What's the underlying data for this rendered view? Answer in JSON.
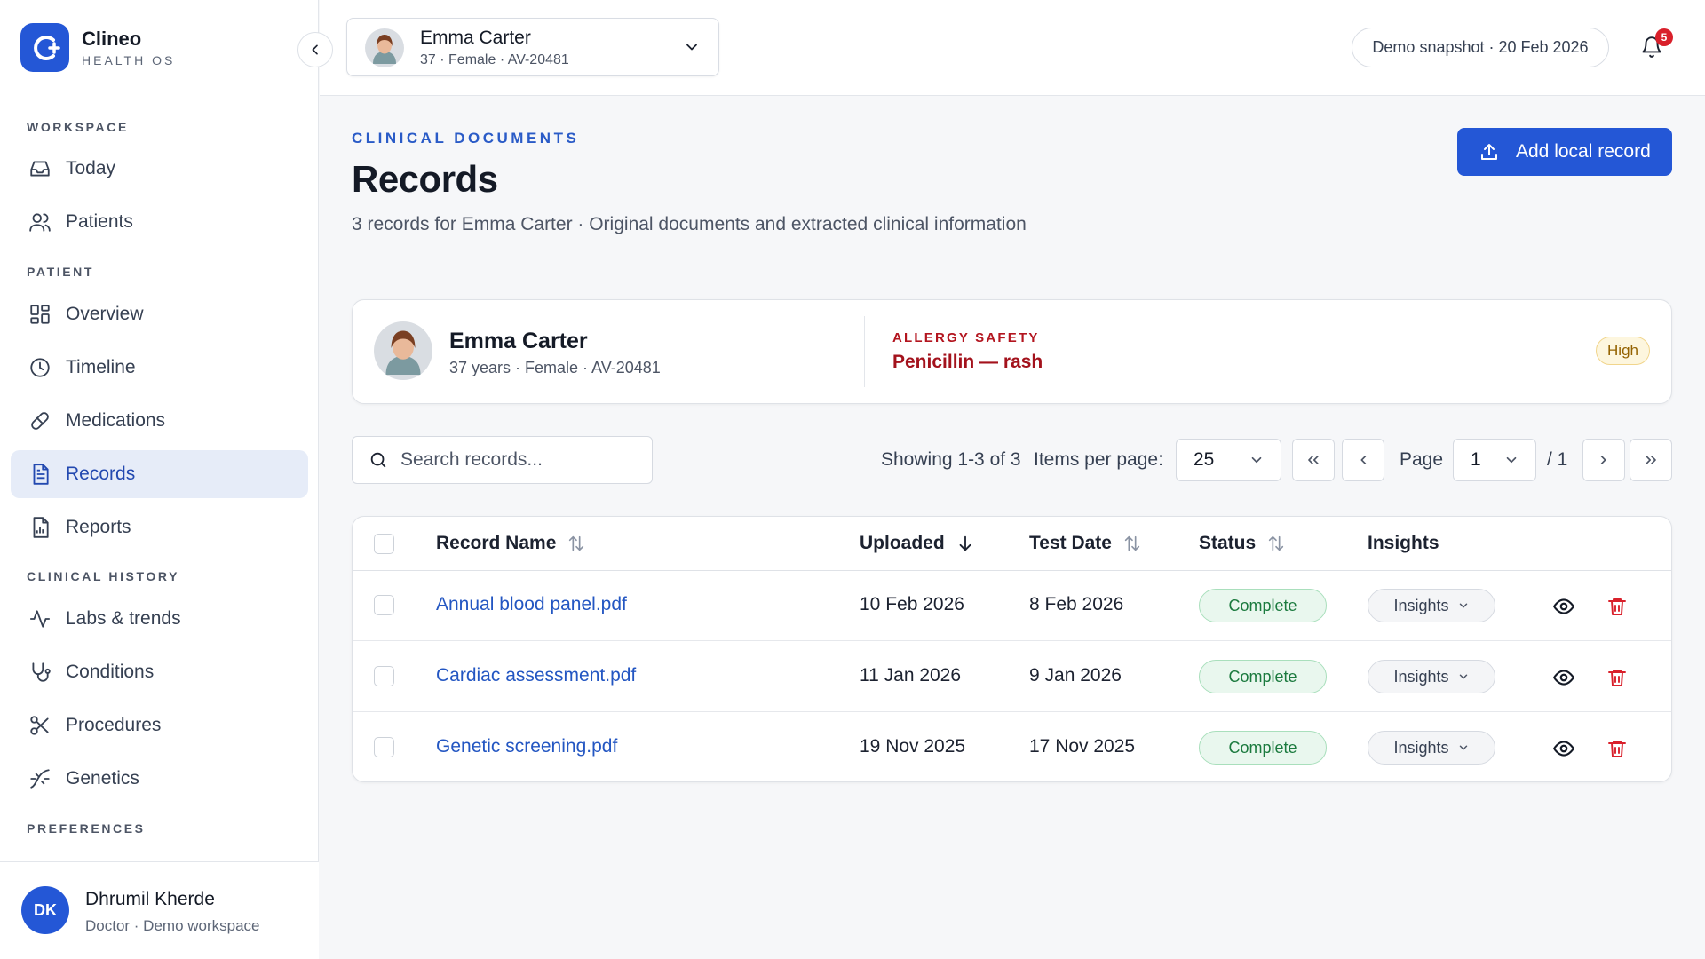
{
  "brand": {
    "name": "Clineo",
    "subtitle": "HEALTH OS"
  },
  "sidebar": {
    "sections": [
      {
        "label": "WORKSPACE"
      },
      {
        "label": "PATIENT"
      },
      {
        "label": "CLINICAL HISTORY"
      },
      {
        "label": "PREFERENCES"
      }
    ],
    "items": [
      {
        "label": "Today",
        "icon": "inbox-icon"
      },
      {
        "label": "Patients",
        "icon": "users-icon"
      },
      {
        "label": "Overview",
        "icon": "grid-icon"
      },
      {
        "label": "Timeline",
        "icon": "clock-icon"
      },
      {
        "label": "Medications",
        "icon": "pill-icon"
      },
      {
        "label": "Records",
        "icon": "document-icon",
        "active": true
      },
      {
        "label": "Reports",
        "icon": "report-icon"
      },
      {
        "label": "Labs & trends",
        "icon": "activity-icon"
      },
      {
        "label": "Conditions",
        "icon": "stethoscope-icon"
      },
      {
        "label": "Procedures",
        "icon": "scissors-icon"
      },
      {
        "label": "Genetics",
        "icon": "dna-icon"
      }
    ]
  },
  "user": {
    "initials": "DK",
    "name": "Dhrumil Kherde",
    "role": "Doctor · Demo workspace"
  },
  "topbar": {
    "patient": {
      "name": "Emma Carter",
      "summary": "37 · Female · AV-20481"
    },
    "snapshot": "Demo snapshot · 20 Feb 2026",
    "notifications_count": "5"
  },
  "page": {
    "eyebrow": "CLINICAL DOCUMENTS",
    "title": "Records",
    "subtitle": "3 records for Emma Carter · Original documents and extracted clinical information",
    "add_button": "Add local record"
  },
  "patient_card": {
    "name": "Emma Carter",
    "details": "37 years · Female · AV-20481",
    "allergy_label": "ALLERGY SAFETY",
    "allergy_value": "Penicillin — rash",
    "severity": "High"
  },
  "toolbar": {
    "search_placeholder": "Search records...",
    "showing": "Showing 1-3 of 3",
    "items_per_page_label": "Items per page:",
    "items_per_page": "25",
    "page_label": "Page",
    "page_current": "1",
    "page_total": "/ 1"
  },
  "table": {
    "columns": [
      "Record Name",
      "Uploaded",
      "Test Date",
      "Status",
      "Insights"
    ],
    "rows": [
      {
        "name": "Annual blood panel.pdf",
        "uploaded": "10 Feb 2026",
        "test_date": "8 Feb 2026",
        "status": "Complete",
        "insights": "Insights"
      },
      {
        "name": "Cardiac assessment.pdf",
        "uploaded": "11 Jan 2026",
        "test_date": "9 Jan 2026",
        "status": "Complete",
        "insights": "Insights"
      },
      {
        "name": "Genetic screening.pdf",
        "uploaded": "19 Nov 2025",
        "test_date": "17 Nov 2025",
        "status": "Complete",
        "insights": "Insights"
      }
    ]
  },
  "colors": {
    "accent": "#2457d6",
    "danger": "#d9202b",
    "success": "#1b7a3e"
  }
}
